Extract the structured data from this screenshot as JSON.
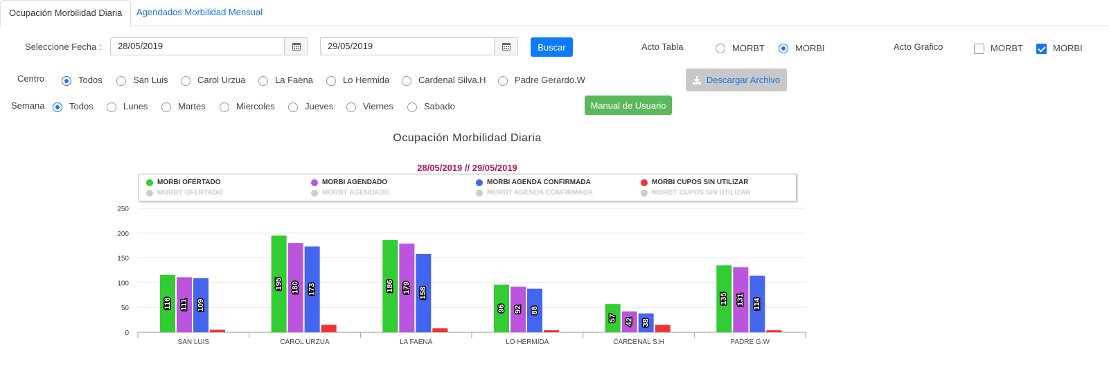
{
  "tabs": [
    {
      "label": "Ocupación Morbilidad Diaria",
      "active": true
    },
    {
      "label": "Agendados Morbilidad Mensual",
      "active": false
    }
  ],
  "filters": {
    "fecha_label": "Seleccione Fecha :",
    "fecha_desde": "28/05/2019",
    "fecha_hasta": "29/05/2019",
    "buscar": "Buscar",
    "acto_tabla_label": "Acto Tabla",
    "acto_tabla_options": [
      {
        "label": "MORBT",
        "selected": false
      },
      {
        "label": "MORBI",
        "selected": true
      }
    ],
    "acto_grafico_label": "Acto Grafico",
    "acto_grafico_options": [
      {
        "label": "MORBT",
        "checked": false
      },
      {
        "label": "MORBI",
        "checked": true
      }
    ],
    "centro_label": "Centro",
    "centro_options": [
      {
        "label": "Todos",
        "selected": true
      },
      {
        "label": "San Luis",
        "selected": false
      },
      {
        "label": "Carol Urzua",
        "selected": false
      },
      {
        "label": "La Faena",
        "selected": false
      },
      {
        "label": "Lo Hermida",
        "selected": false
      },
      {
        "label": "Cardenal Silva.H",
        "selected": false
      },
      {
        "label": "Padre Gerardo.W",
        "selected": false
      }
    ],
    "descargar": "Descargar Archivo",
    "semana_label": "Semana",
    "semana_options": [
      {
        "label": "Todos",
        "selected": true
      },
      {
        "label": "Lunes",
        "selected": false
      },
      {
        "label": "Martes",
        "selected": false
      },
      {
        "label": "Miercoles",
        "selected": false
      },
      {
        "label": "Jueves",
        "selected": false
      },
      {
        "label": "Viernes",
        "selected": false
      },
      {
        "label": "Sabado",
        "selected": false
      }
    ],
    "manual": "Manual de Usuario"
  },
  "colors": {
    "accent": "#0d7bfa",
    "green_btn": "#5cb85c",
    "subtitle": "#b0155e"
  },
  "chart_data": {
    "type": "bar",
    "title": "Ocupación Morbilidad Diaria",
    "subtitle": "28/05/2019 // 29/05/2019",
    "categories": [
      "SAN LUIS",
      "CAROL URZUA",
      "LA FAENA",
      "LO HERMIDA",
      "CARDENAL S.H",
      "PADRE G.W"
    ],
    "ylim": [
      0,
      250
    ],
    "yticks": [
      0,
      50,
      100,
      150,
      200,
      250
    ],
    "grid": true,
    "legend_position": "top",
    "series": [
      {
        "name": "MORBI OFERTADO",
        "color": "#33cc33",
        "values": [
          116,
          195,
          186,
          96,
          57,
          135
        ],
        "visible": true
      },
      {
        "name": "MORBI AGENDADO",
        "color": "#bb55dd",
        "values": [
          111,
          180,
          179,
          92,
          42,
          131
        ],
        "visible": true
      },
      {
        "name": "MORBI AGENDA CONFIRMADA",
        "color": "#4466ee",
        "values": [
          109,
          173,
          158,
          88,
          38,
          114
        ],
        "visible": true
      },
      {
        "name": "MORBI CUPOS SIN UTILIZAR",
        "color": "#ee3333",
        "values": [
          5,
          15,
          8,
          4,
          15,
          4
        ],
        "visible": true
      },
      {
        "name": "MORBT OFERTADO",
        "color": "#cccccc",
        "values": [],
        "visible": false
      },
      {
        "name": "MORBT AGENDADO",
        "color": "#cccccc",
        "values": [],
        "visible": false
      },
      {
        "name": "MORBT AGENDA CONFIRMADA",
        "color": "#cccccc",
        "values": [],
        "visible": false
      },
      {
        "name": "MORBT CUPOS SIN UTILIZAR",
        "color": "#cccccc",
        "values": [],
        "visible": false
      }
    ],
    "data_labels_series": [
      0,
      1,
      2
    ]
  }
}
